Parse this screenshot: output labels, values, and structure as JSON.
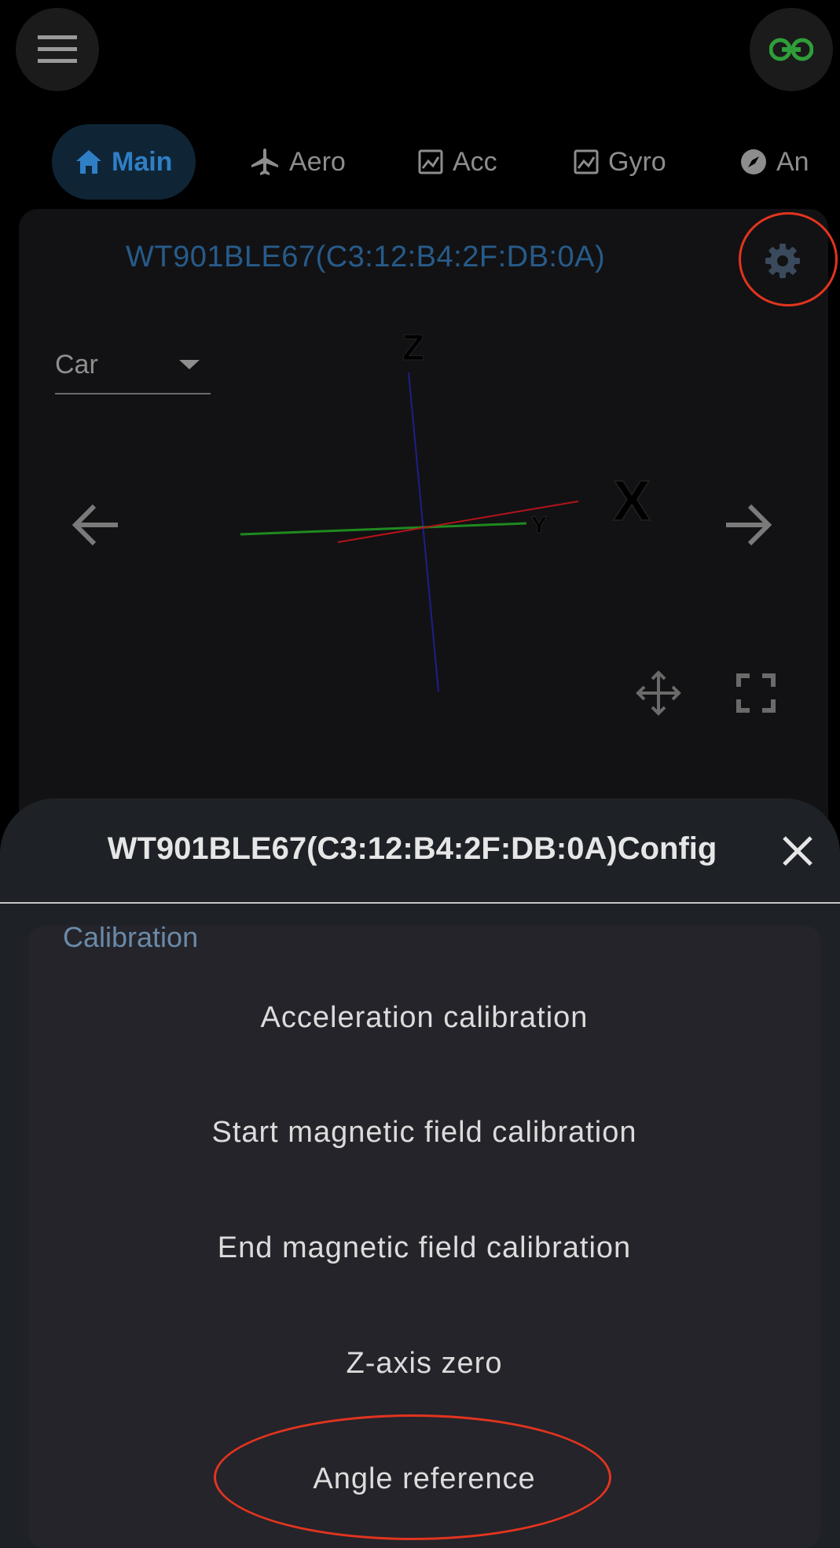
{
  "tabs": [
    {
      "label": "Main",
      "icon": "home-icon",
      "active": true
    },
    {
      "label": "Aero",
      "icon": "airplane-icon"
    },
    {
      "label": "Acc",
      "icon": "chart-icon"
    },
    {
      "label": "Gyro",
      "icon": "chart-icon"
    },
    {
      "label": "An",
      "icon": "compass-icon"
    }
  ],
  "device": {
    "title": "WT901BLE67(C3:12:B4:2F:DB:0A)",
    "model_select": "Car"
  },
  "axes": {
    "x_label": "X",
    "y_label": "Y",
    "z_label": "Z"
  },
  "config_sheet": {
    "title": "WT901BLE67(C3:12:B4:2F:DB:0A)Config",
    "section_label": "Calibration",
    "items": [
      "Acceleration calibration",
      "Start magnetic field calibration",
      "End magnetic field calibration",
      "Z-axis zero",
      "Angle reference"
    ]
  },
  "colors": {
    "accent": "#2f7fc6",
    "link_icon": "#2f9e3a",
    "annotation_ring": "#e2341f",
    "axis_x": "#b3141a",
    "axis_y": "#1f8a1f",
    "axis_z": "#1e1e8a"
  }
}
